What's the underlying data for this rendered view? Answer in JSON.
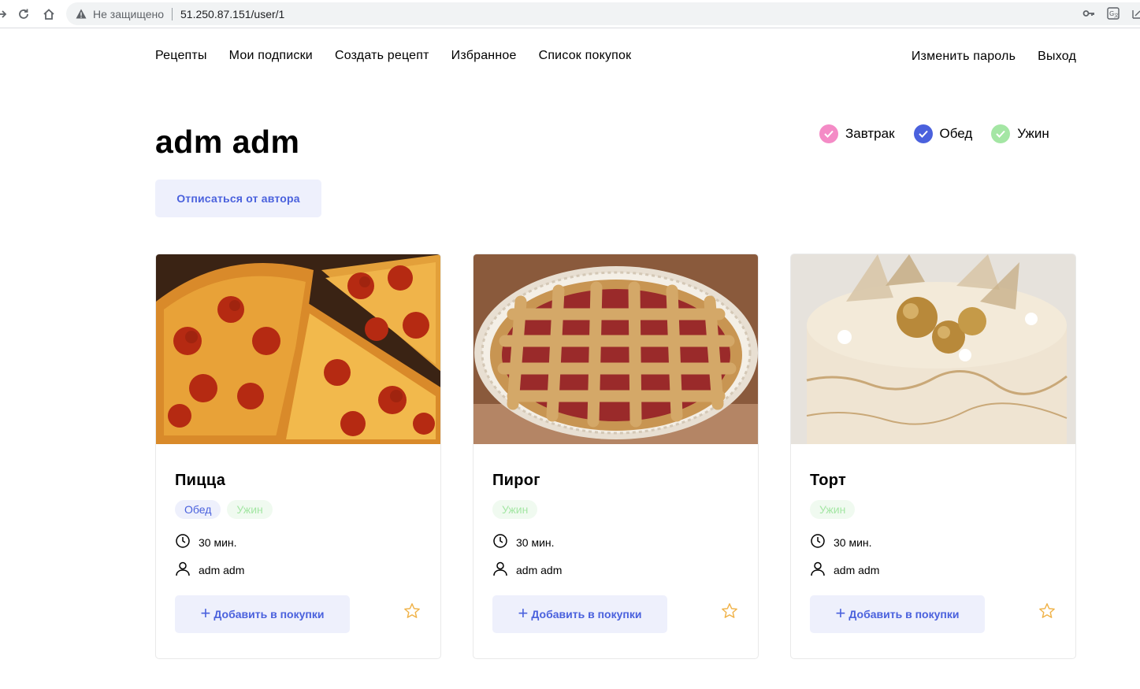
{
  "browser": {
    "security_label": "Не защищено",
    "url": "51.250.87.151/user/1"
  },
  "nav": {
    "items": [
      {
        "label": "Рецепты"
      },
      {
        "label": "Мои подписки"
      },
      {
        "label": "Создать рецепт"
      },
      {
        "label": "Избранное"
      },
      {
        "label": "Список покупок"
      }
    ],
    "change_password": "Изменить пароль",
    "logout": "Выход"
  },
  "profile": {
    "name": "adm adm",
    "unsubscribe_label": "Отписаться от автора"
  },
  "filters": [
    {
      "label": "Завтрак",
      "color": "#f48bc6"
    },
    {
      "label": "Обед",
      "color": "#4a61dd"
    },
    {
      "label": "Ужин",
      "color": "#a4e6a4"
    }
  ],
  "cards": [
    {
      "title": "Пицца",
      "tags": [
        {
          "label": "Обед"
        },
        {
          "label": "Ужин"
        }
      ],
      "time": "30 мин.",
      "author": "adm adm",
      "add_label": "Добавить в покупки"
    },
    {
      "title": "Пирог",
      "tags": [
        {
          "label": "Ужин"
        }
      ],
      "time": "30 мин.",
      "author": "adm adm",
      "add_label": "Добавить в покупки"
    },
    {
      "title": "Торт",
      "tags": [
        {
          "label": "Ужин"
        }
      ],
      "time": "30 мин.",
      "author": "adm adm",
      "add_label": "Добавить в покупки"
    }
  ],
  "colors": {
    "accent": "#4a61dd",
    "button_bg": "#eef0fc",
    "star": "#f0b34a"
  }
}
